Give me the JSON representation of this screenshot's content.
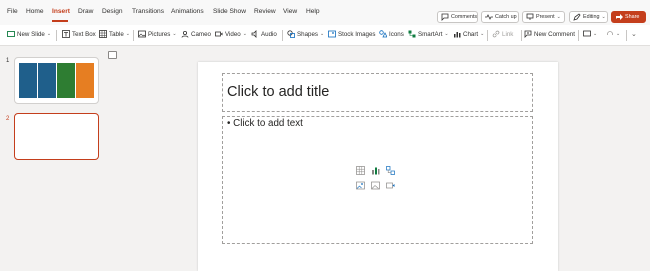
{
  "tabs": [
    "File",
    "Home",
    "Insert",
    "Draw",
    "Design",
    "Transitions",
    "Animations",
    "Slide Show",
    "Review",
    "View",
    "Help"
  ],
  "active_tab": "Insert",
  "right_buttons": {
    "comments": "Comments",
    "catchup": "Catch up",
    "present": "Present",
    "editing": "Editing",
    "share": "Share"
  },
  "toolbar": {
    "new_slide": "New Slide",
    "text_box": "Text Box",
    "table": "Table",
    "pictures": "Pictures",
    "cameo": "Cameo",
    "video": "Video",
    "audio": "Audio",
    "shapes": "Shapes",
    "stock_images": "Stock Images",
    "icons": "Icons",
    "smartart": "SmartArt",
    "chart": "Chart",
    "link": "Link",
    "new_comment": "New Comment"
  },
  "slides": [
    {
      "number": "1",
      "selected": false
    },
    {
      "number": "2",
      "selected": true
    }
  ],
  "thumb1_colors": [
    "#1f5f8b",
    "#1f5f8b",
    "#2e7d32",
    "#e67e22"
  ],
  "canvas": {
    "title_placeholder": "Click to add title",
    "body_placeholder": "• Click to add text"
  },
  "colors": {
    "accent": "#c43e1c",
    "ribbon_bg": "#f8f8f8",
    "workspace_bg": "#f3f2f1"
  }
}
